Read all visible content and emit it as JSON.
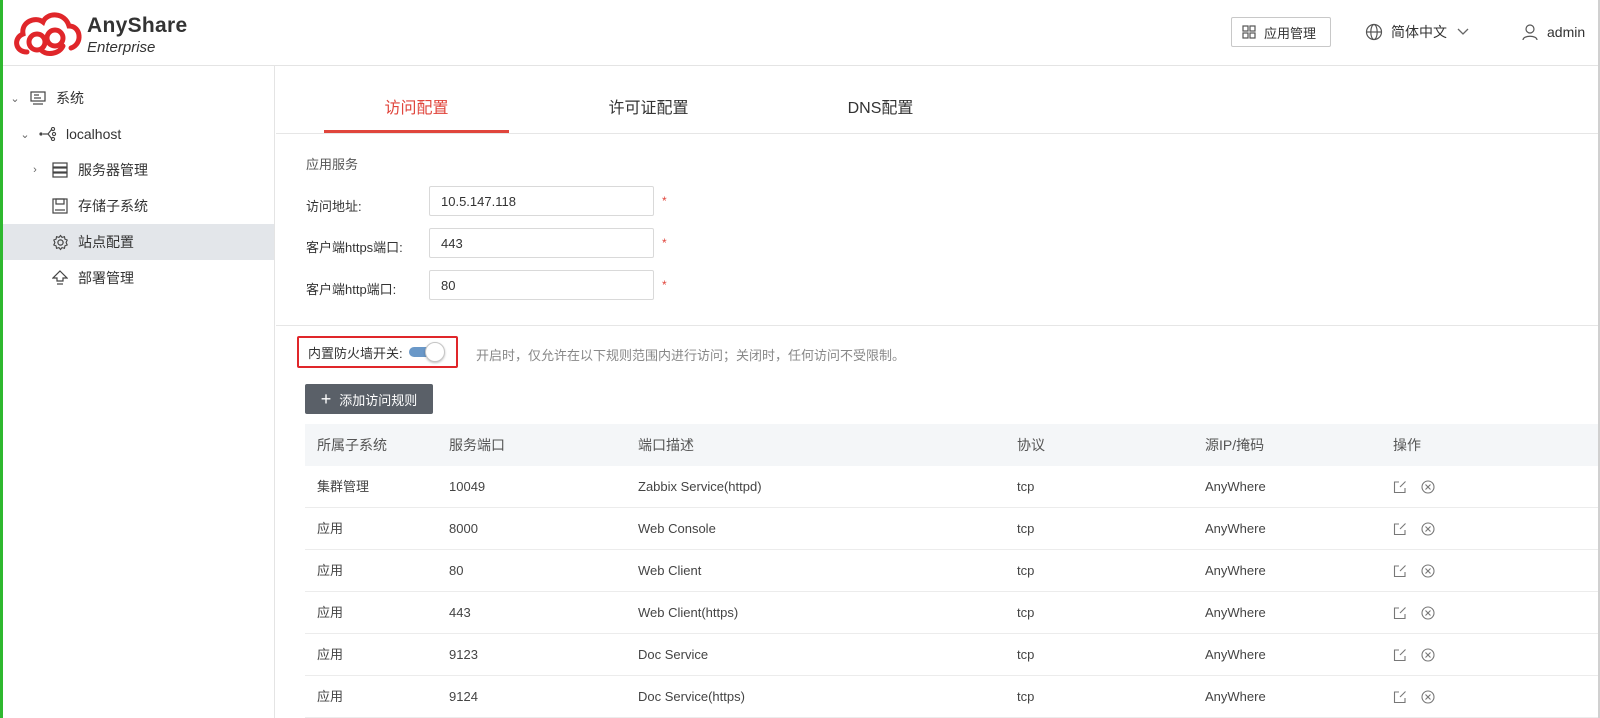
{
  "header": {
    "brand_name": "AnyShare",
    "brand_sub": "Enterprise",
    "app_mgmt_label": "应用管理",
    "language": "简体中文",
    "user": "admin"
  },
  "sidebar": {
    "items": [
      {
        "label": "系统",
        "icon": "monitor-icon",
        "expanded": true
      },
      {
        "label": "localhost",
        "icon": "network-node-icon",
        "expanded": true
      },
      {
        "label": "服务器管理",
        "icon": "server-icon",
        "expanded": false
      },
      {
        "label": "存储子系统",
        "icon": "storage-icon"
      },
      {
        "label": "站点配置",
        "icon": "gear-icon",
        "active": true
      },
      {
        "label": "部署管理",
        "icon": "upload-arrow-icon"
      }
    ]
  },
  "tabs": [
    {
      "label": "访问配置",
      "active": true
    },
    {
      "label": "许可证配置"
    },
    {
      "label": "DNS配置"
    }
  ],
  "form": {
    "section_title": "应用服务",
    "address_label": "访问地址:",
    "address_value": "10.5.147.118",
    "https_label": "客户端https端口:",
    "https_value": "443",
    "http_label": "客户端http端口:",
    "http_value": "80",
    "required_mark": "*"
  },
  "firewall": {
    "label": "内置防火墙开关:",
    "enabled": true,
    "hint": "开启时，仅允许在以下规则范围内进行访问；关闭时，任何访问不受限制。"
  },
  "add_rule_label": "添加访问规则",
  "table": {
    "headers": [
      "所属子系统",
      "服务端口",
      "端口描述",
      "协议",
      "源IP/掩码",
      "操作"
    ],
    "rows": [
      [
        "集群管理",
        "10049",
        "Zabbix Service(httpd)",
        "tcp",
        "AnyWhere"
      ],
      [
        "应用",
        "8000",
        "Web Console",
        "tcp",
        "AnyWhere"
      ],
      [
        "应用",
        "80",
        "Web Client",
        "tcp",
        "AnyWhere"
      ],
      [
        "应用",
        "443",
        "Web Client(https)",
        "tcp",
        "AnyWhere"
      ],
      [
        "应用",
        "9123",
        "Doc Service",
        "tcp",
        "AnyWhere"
      ],
      [
        "应用",
        "9124",
        "Doc Service(https)",
        "tcp",
        "AnyWhere"
      ]
    ]
  },
  "colors": {
    "accent": "#e0453c",
    "highlight_border": "#e0262a",
    "toggle_on": "#6a98c8",
    "add_button": "#5a6068"
  }
}
